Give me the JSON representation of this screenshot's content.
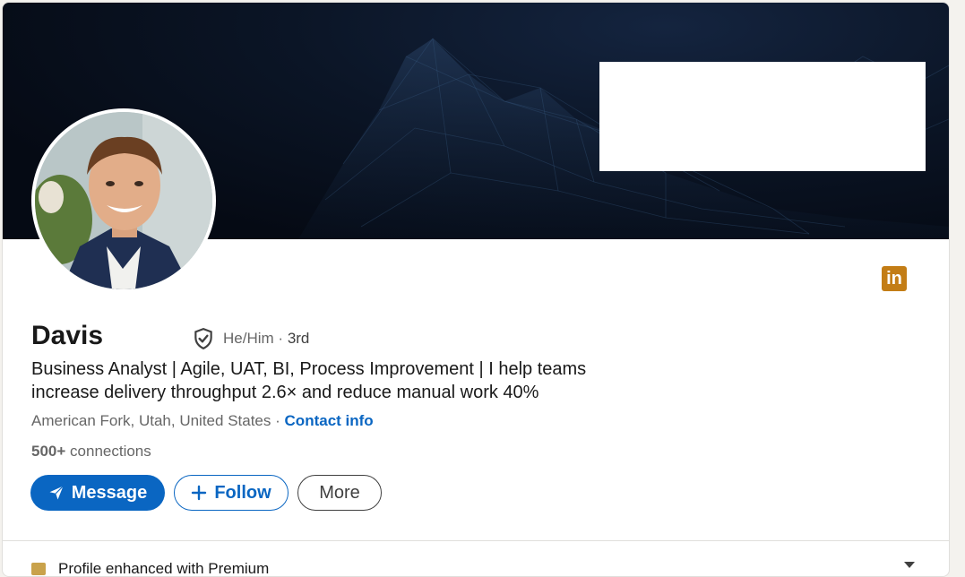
{
  "profile": {
    "name": "Davis",
    "pronouns": "He/Him",
    "separator": "·",
    "degree": "3rd",
    "headline": "Business Analyst | Agile, UAT, BI, Process Improvement | I help teams increase delivery throughput 2.6× and reduce manual work 40%",
    "location": "American Fork, Utah, United States",
    "location_separator": "·",
    "contact_label": "Contact info",
    "connections_count": "500+",
    "connections_label": "connections"
  },
  "actions": {
    "message_label": "Message",
    "follow_label": "Follow",
    "more_label": "More"
  },
  "premium": {
    "label": "Profile enhanced with Premium"
  },
  "icons": {
    "verification": "shield-check-icon",
    "brand": "linkedin-icon",
    "message": "paper-plane-icon",
    "follow": "plus-icon",
    "premium": "premium-icon",
    "expand": "chevron-down-icon"
  },
  "colors": {
    "primary": "#0a66c2",
    "brand_badge": "#c37d16",
    "text": "#191919",
    "muted": "#666666"
  }
}
